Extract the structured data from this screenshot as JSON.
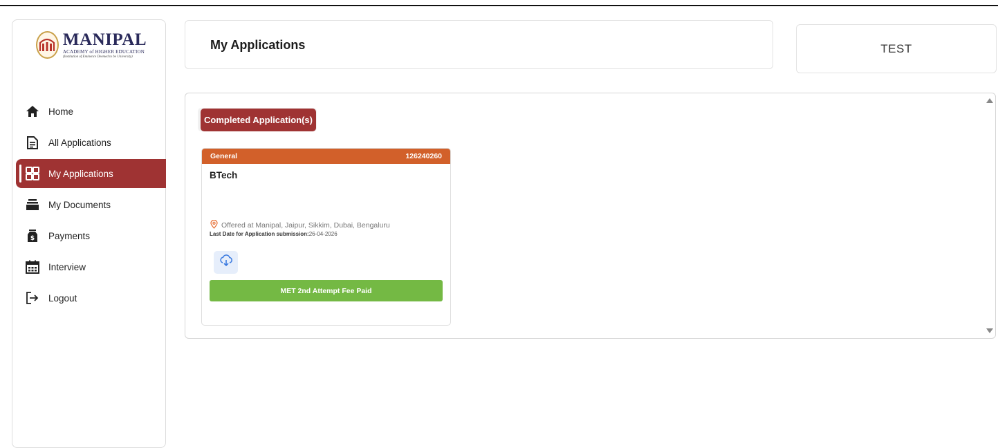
{
  "brand": {
    "name": "MANIPAL",
    "subtitle": "ACADEMY of HIGHER EDUCATION",
    "tagline": "(Institution of Eminence Deemed to be University)",
    "emblem_icon": "manipal-emblem-icon"
  },
  "sidebar": {
    "items": [
      {
        "label": "Home",
        "icon": "home-icon"
      },
      {
        "label": "All Applications",
        "icon": "document-icon"
      },
      {
        "label": "My Applications",
        "icon": "grid-icon",
        "active": true
      },
      {
        "label": "My Documents",
        "icon": "stack-icon"
      },
      {
        "label": "Payments",
        "icon": "money-bag-icon"
      },
      {
        "label": "Interview",
        "icon": "calendar-icon"
      },
      {
        "label": "Logout",
        "icon": "logout-icon"
      }
    ]
  },
  "header": {
    "title": "My Applications"
  },
  "user": {
    "name": "TEST"
  },
  "main": {
    "section_tab": "Completed Application(s)",
    "applications": [
      {
        "category": "General",
        "application_id": "126240260",
        "program": "BTech",
        "offered_at": "Offered at Manipal, Jaipur, Sikkim, Dubai, Bengaluru",
        "last_date_label": "Last Date for Application submission:",
        "last_date_value": "26-04-2026",
        "status": "MET 2nd Attempt Fee Paid"
      }
    ]
  },
  "colors": {
    "primary": "#9f3333",
    "card_header": "#d2602a",
    "status_ok": "#74b944",
    "download_bg": "#e6eefb",
    "download_icon": "#3c7be0",
    "pin": "#e8743b"
  }
}
